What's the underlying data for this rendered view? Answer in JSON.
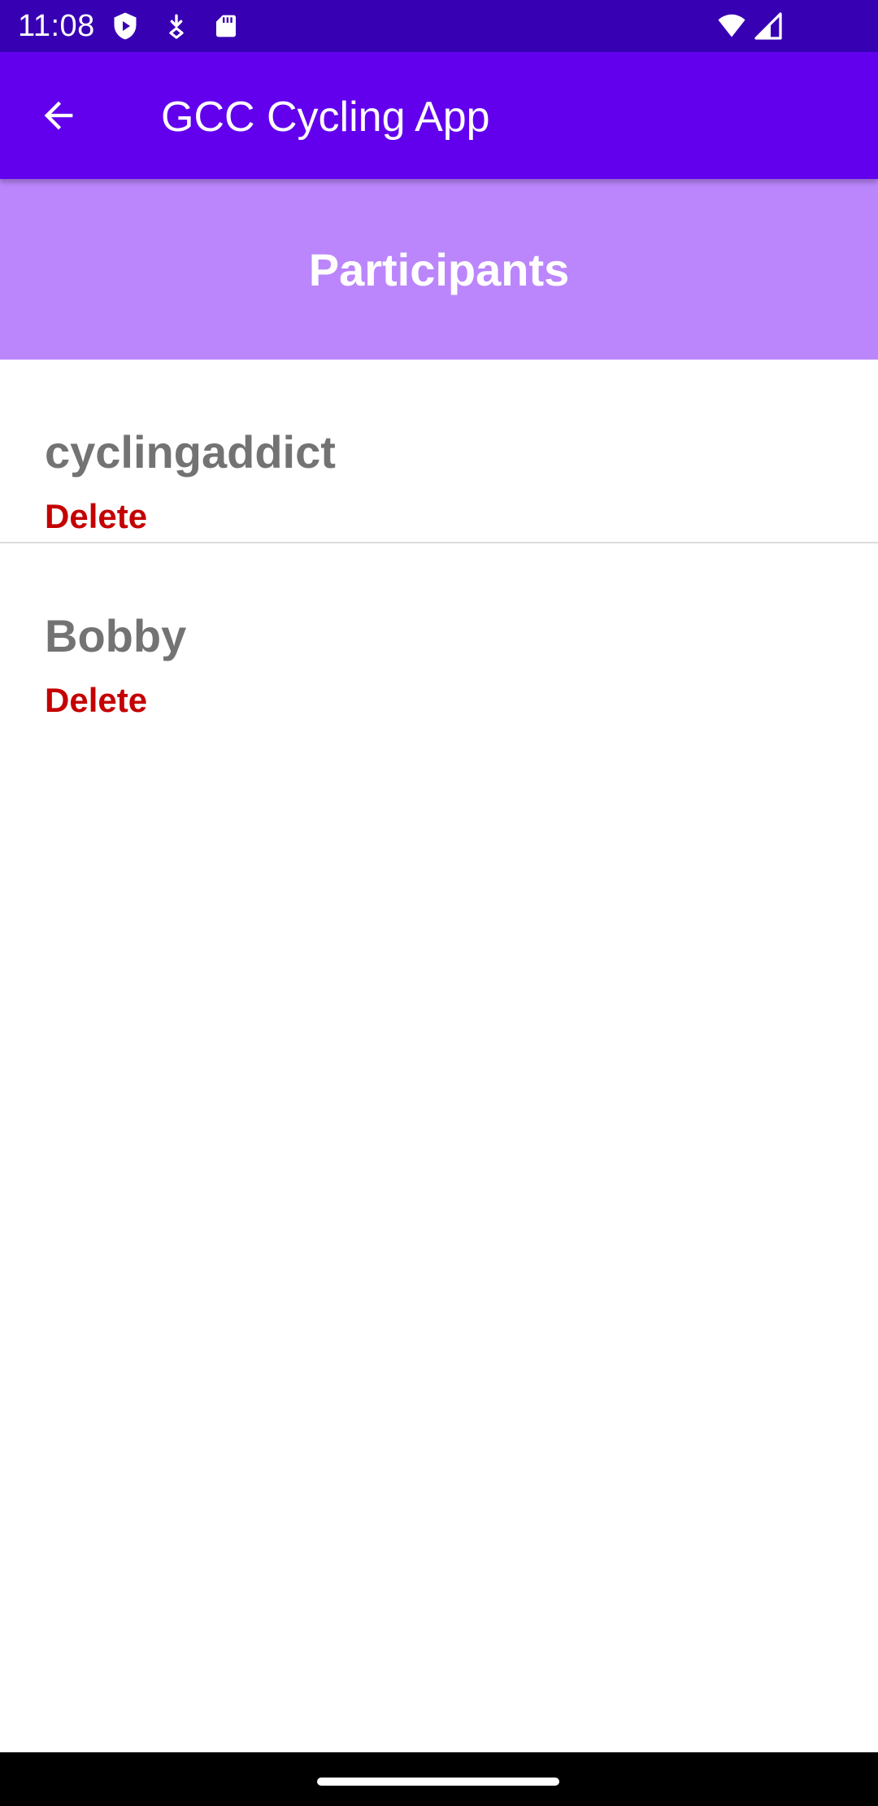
{
  "status_bar": {
    "time": "11:08",
    "icons_left": [
      "shield-play-icon",
      "download-notification-icon",
      "sd-card-icon"
    ],
    "icons_right": [
      "wifi-icon",
      "cell-signal-icon"
    ],
    "background": "#3700b3"
  },
  "app_bar": {
    "back_icon": "arrow-back-icon",
    "title": "GCC Cycling App",
    "background": "#6200ee"
  },
  "header": {
    "title": "Participants",
    "background": "#bb86fc"
  },
  "participants": [
    {
      "name": "cyclingaddict",
      "delete_label": "Delete"
    },
    {
      "name": "Bobby",
      "delete_label": "Delete"
    }
  ],
  "colors": {
    "name_text": "#737373",
    "delete_text": "#c40000"
  }
}
